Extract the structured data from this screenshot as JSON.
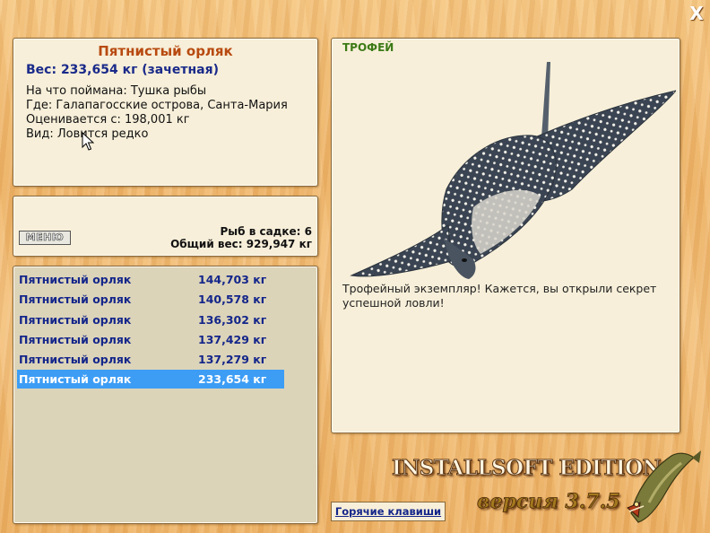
{
  "window": {
    "close_glyph": "X"
  },
  "info": {
    "title": "Пятнистый орляк",
    "weight": "Вес: 233,654 кг (зачетная)",
    "caught_on": "На что поймана: Тушка рыбы",
    "location": "Где: Галапагосские острова, Санта-Мария",
    "valued_from": "Оценивается с: 198,001 кг",
    "kind": "Вид: Ловится редко"
  },
  "keepnet": {
    "menu_label": "МЕНЮ",
    "fish_count": "Рыб в садке: 6",
    "total_weight": "Общий вес: 929,947 кг"
  },
  "catch_list": [
    {
      "name": "Пятнистый орляк",
      "weight": "144,703 кг"
    },
    {
      "name": "Пятнистый орляк",
      "weight": "140,578 кг"
    },
    {
      "name": "Пятнистый орляк",
      "weight": "136,302 кг"
    },
    {
      "name": "Пятнистый орляк",
      "weight": "137,429 кг"
    },
    {
      "name": "Пятнистый орляк",
      "weight": "137,279 кг"
    },
    {
      "name": "Пятнистый орляк",
      "weight": "233,654 кг",
      "selected": true
    }
  ],
  "trophy": {
    "label": "ТРОФЕЙ",
    "text": "Трофейный экземпляр! Кажется, вы открыли секрет успешной ловли!"
  },
  "footer": {
    "hotkeys_label": "Горячие клавиши",
    "edition": "INSTALLSOFT EDITION",
    "version": "версия 3.7.5"
  },
  "icons": [
    "close-icon",
    "spotted-eagle-ray-image",
    "pike-logo-icon",
    "mouse-cursor-icon"
  ],
  "colors": {
    "title": "#b84a10",
    "weight": "#1a2a8a",
    "list_text": "#14268a",
    "selection": "#3d9df5",
    "trophy_label": "#3c7a16"
  }
}
